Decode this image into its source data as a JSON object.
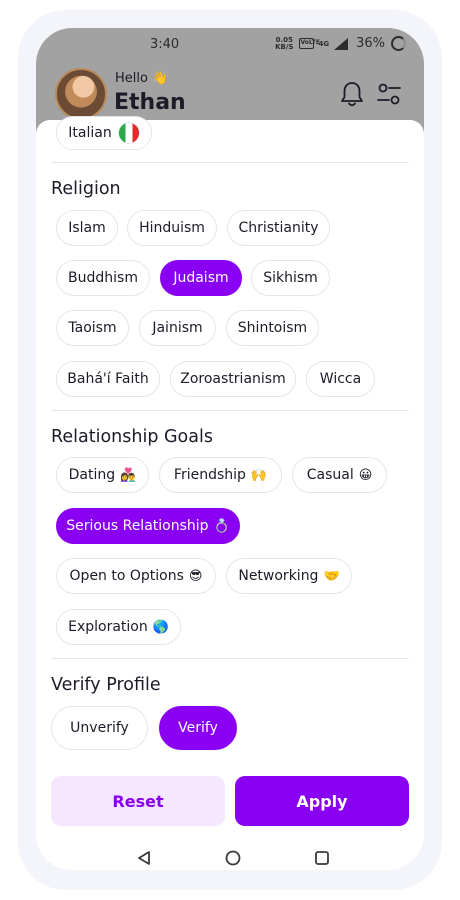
{
  "status_bar": {
    "time": "3:40",
    "net_speed_value": "0.05",
    "net_speed_unit": "KB/S",
    "volte_label": "VoLTE",
    "network_label": "4G",
    "battery": "36%"
  },
  "header": {
    "greeting": "Hello 👋",
    "user_name": "Ethan"
  },
  "language": {
    "partial_chip": "Italian"
  },
  "religion": {
    "title": "Religion",
    "options": [
      "Islam",
      "Hinduism",
      "Christianity",
      "Buddhism",
      "Judaism",
      "Sikhism",
      "Taoism",
      "Jainism",
      "Shintoism",
      "Bahá'í Faith",
      "Zoroastrianism",
      "Wicca"
    ],
    "selected": "Judaism"
  },
  "relationship_goals": {
    "title": "Relationship Goals",
    "options": [
      {
        "label": "Dating",
        "emoji": "👩‍❤️‍👨"
      },
      {
        "label": "Friendship",
        "emoji": "🙌"
      },
      {
        "label": "Casual",
        "emoji": "😀"
      },
      {
        "label": "Serious Relationship",
        "emoji": "💍"
      },
      {
        "label": "Open to Options",
        "emoji": "😎"
      },
      {
        "label": "Networking",
        "emoji": "🤝"
      },
      {
        "label": "Exploration",
        "emoji": "🌎"
      }
    ],
    "selected": "Serious Relationship"
  },
  "verify_profile": {
    "title": "Verify Profile",
    "options": [
      "Unverify",
      "Verify"
    ],
    "selected": "Verify"
  },
  "actions": {
    "reset_label": "Reset",
    "apply_label": "Apply"
  },
  "colors": {
    "accent": "#8a00f2",
    "accent_light": "#f4e7ff",
    "chip_border": "#e4e4ec",
    "overlay": "#a2a2a2"
  },
  "icons": {
    "bell": "bell-icon",
    "filter": "filter-icon",
    "nav_back": "back-triangle-icon",
    "nav_home": "home-circle-icon",
    "nav_recents": "recents-square-icon"
  }
}
